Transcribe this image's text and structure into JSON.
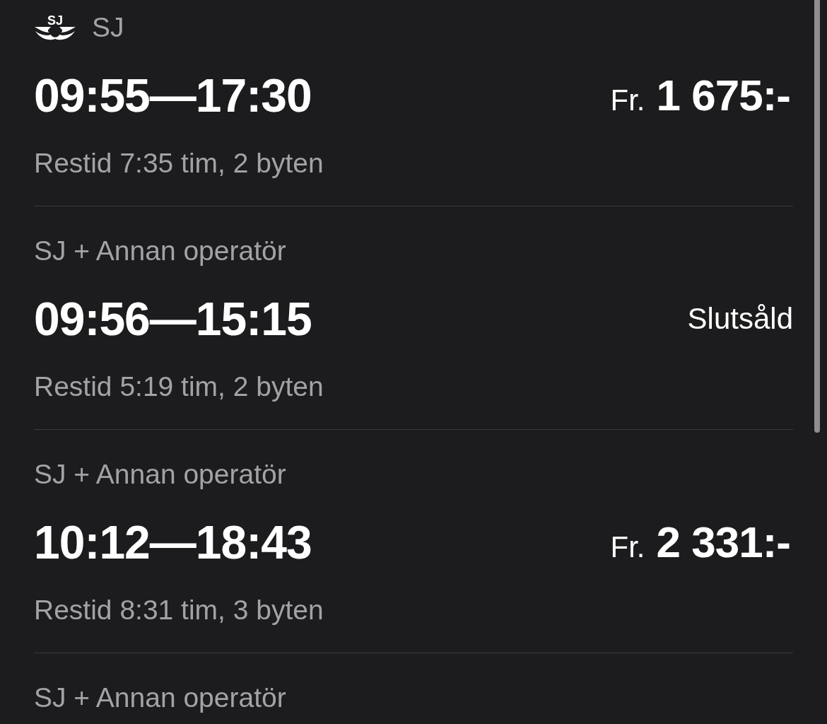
{
  "journeys": [
    {
      "operator": "SJ",
      "logo": true,
      "logo_text": "SJ",
      "times": "09:55—17:30",
      "duration": "Restid 7:35 tim, 2 byten",
      "fare": {
        "kind": "price",
        "prefix": "Fr.",
        "amount": "1 675:-"
      }
    },
    {
      "operator": "SJ + Annan operatör",
      "logo": false,
      "times": "09:56—15:15",
      "duration": "Restid 5:19 tim, 2 byten",
      "fare": {
        "kind": "status",
        "label": "Slutsåld"
      }
    },
    {
      "operator": "SJ + Annan operatör",
      "logo": false,
      "times": "10:12—18:43",
      "duration": "Restid 8:31 tim, 3 byten",
      "fare": {
        "kind": "price",
        "prefix": "Fr.",
        "amount": "2 331:-"
      }
    },
    {
      "operator": "SJ + Annan operatör",
      "logo": false
    }
  ]
}
